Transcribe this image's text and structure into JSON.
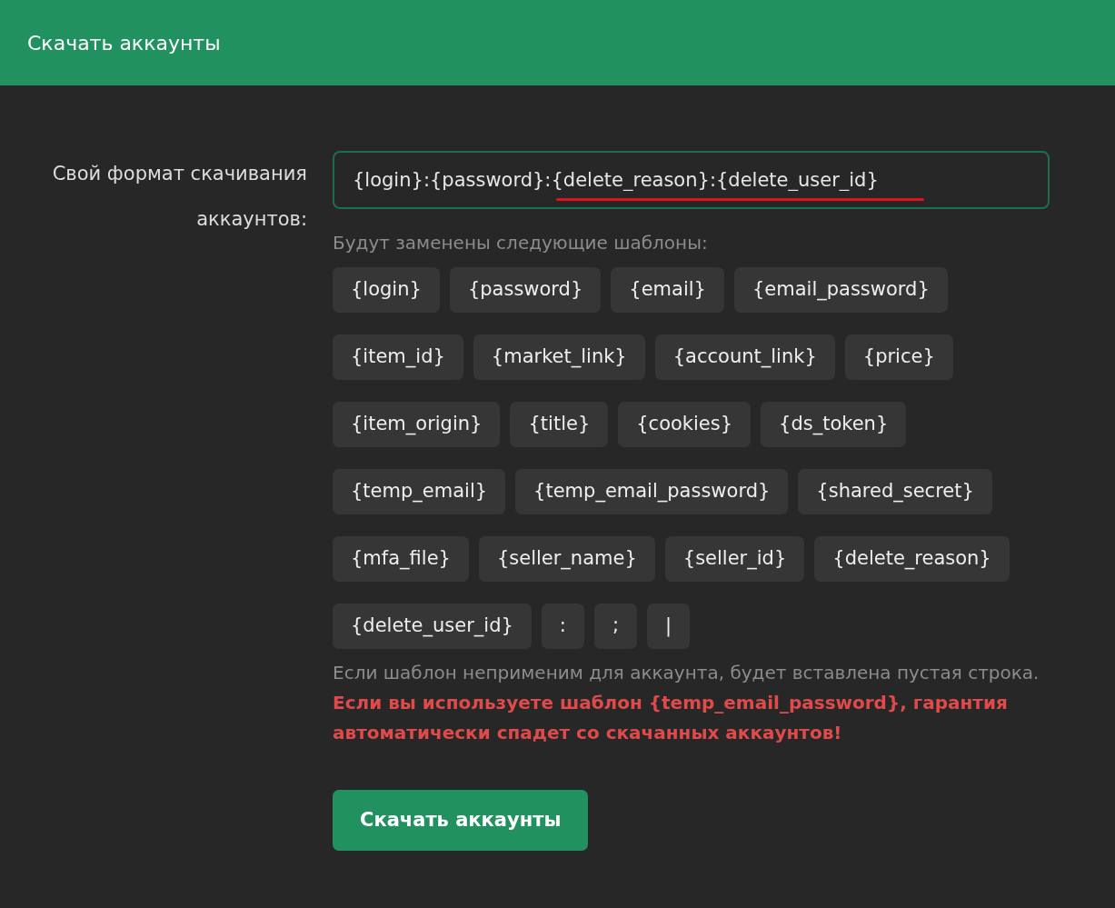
{
  "header": {
    "title": "Скачать аккаунты"
  },
  "format_field": {
    "label": "Свой формат скачивания аккаунтов:",
    "value": "{login}:{password}:{delete_reason}:{delete_user_id}"
  },
  "templates_hint": "Будут заменены следующие шаблоны:",
  "templates": [
    "{login}",
    "{password}",
    "{email}",
    "{email_password}",
    "{item_id}",
    "{market_link}",
    "{account_link}",
    "{price}",
    "{item_origin}",
    "{title}",
    "{cookies}",
    "{ds_token}",
    "{temp_email}",
    "{temp_email_password}",
    "{shared_secret}",
    "{mfa_file}",
    "{seller_name}",
    "{seller_id}",
    "{delete_reason}",
    "{delete_user_id}",
    ":",
    ";",
    "|"
  ],
  "note": "Если шаблон неприменим для аккаунта, будет вставлена пустая строка. **Если вы используете шаблон {temp_email_password}, гарантия автоматически спадет со скачанных аккаунтов!**",
  "submit_button": "Скачать аккаунты"
}
